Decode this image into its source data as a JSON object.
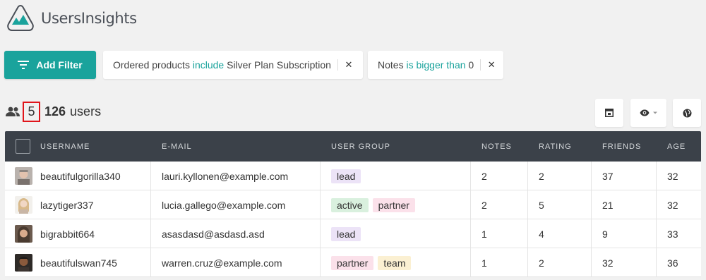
{
  "app": {
    "name": "UsersInsights"
  },
  "toolbar": {
    "add_filter_label": "Add Filter"
  },
  "filters": [
    {
      "field": "Ordered products",
      "operator": "include",
      "value": "Silver Plan Subscription"
    },
    {
      "field": "Notes",
      "operator": "is bigger than",
      "value": "0"
    }
  ],
  "summary": {
    "shown": "5",
    "sep": "/",
    "total": "126",
    "unit": "users"
  },
  "columns": [
    "USERNAME",
    "E-MAIL",
    "USER GROUP",
    "NOTES",
    "RATING",
    "FRIENDS",
    "AGE"
  ],
  "rows": [
    {
      "username": "beautifulgorilla340",
      "email": "lauri.kyllonen@example.com",
      "groups": [
        "lead"
      ],
      "notes": "2",
      "rating": "2",
      "friends": "37",
      "age": "32"
    },
    {
      "username": "lazytiger337",
      "email": "lucia.gallego@example.com",
      "groups": [
        "active",
        "partner"
      ],
      "notes": "2",
      "rating": "5",
      "friends": "21",
      "age": "32"
    },
    {
      "username": "bigrabbit664",
      "email": "asasdasd@asdasd.asd",
      "groups": [
        "lead"
      ],
      "notes": "1",
      "rating": "4",
      "friends": "9",
      "age": "33"
    },
    {
      "username": "beautifulswan745",
      "email": "warren.cruz@example.com",
      "groups": [
        "partner",
        "team"
      ],
      "notes": "1",
      "rating": "2",
      "friends": "32",
      "age": "36"
    }
  ],
  "tag_colors": {
    "lead": {
      "bg": "#ece3f7",
      "fg": "#444"
    },
    "active": {
      "bg": "#d9f0de",
      "fg": "#444"
    },
    "partner": {
      "bg": "#fbe1ea",
      "fg": "#444"
    },
    "team": {
      "bg": "#fbf0d2",
      "fg": "#444"
    }
  },
  "colors": {
    "accent": "#1aa39c",
    "header_bg": "#3b4149",
    "highlight": "#e0151b"
  }
}
